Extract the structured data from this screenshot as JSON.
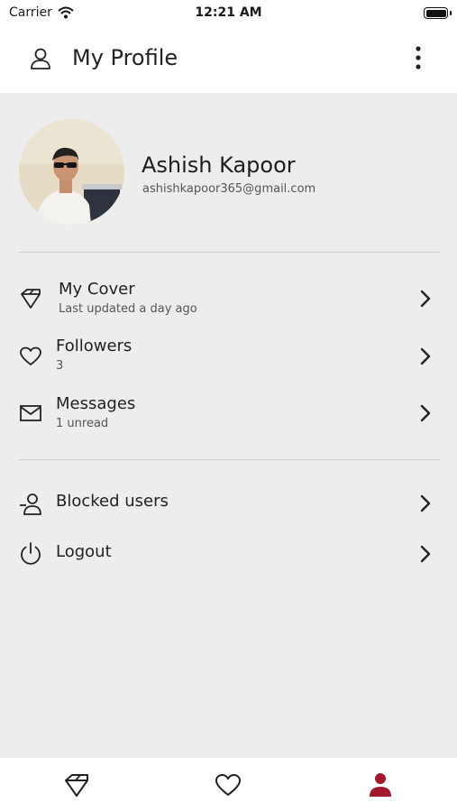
{
  "status": {
    "carrier": "Carrier",
    "time": "12:21 AM"
  },
  "header": {
    "title": "My Profile"
  },
  "profile": {
    "name": "Ashish Kapoor",
    "email": "ashishkapoor365@gmail.com"
  },
  "menu": [
    {
      "label": "My Cover",
      "sublabel": "Last updated a day ago",
      "icon": "diamond-icon"
    },
    {
      "label": "Followers",
      "sublabel": "3",
      "icon": "heart-icon"
    },
    {
      "label": "Messages",
      "sublabel": "1 unread",
      "icon": "mail-icon"
    }
  ],
  "menu2": [
    {
      "label": "Blocked users",
      "icon": "user-blocked-icon"
    },
    {
      "label": "Logout",
      "icon": "power-icon"
    }
  ],
  "tabs": [
    {
      "icon": "diamond-icon",
      "active": false
    },
    {
      "icon": "heart-icon",
      "active": false
    },
    {
      "icon": "person-icon",
      "active": true
    }
  ],
  "colors": {
    "accent": "#a3182c",
    "background": "#ededed",
    "surface": "#ffffff"
  }
}
